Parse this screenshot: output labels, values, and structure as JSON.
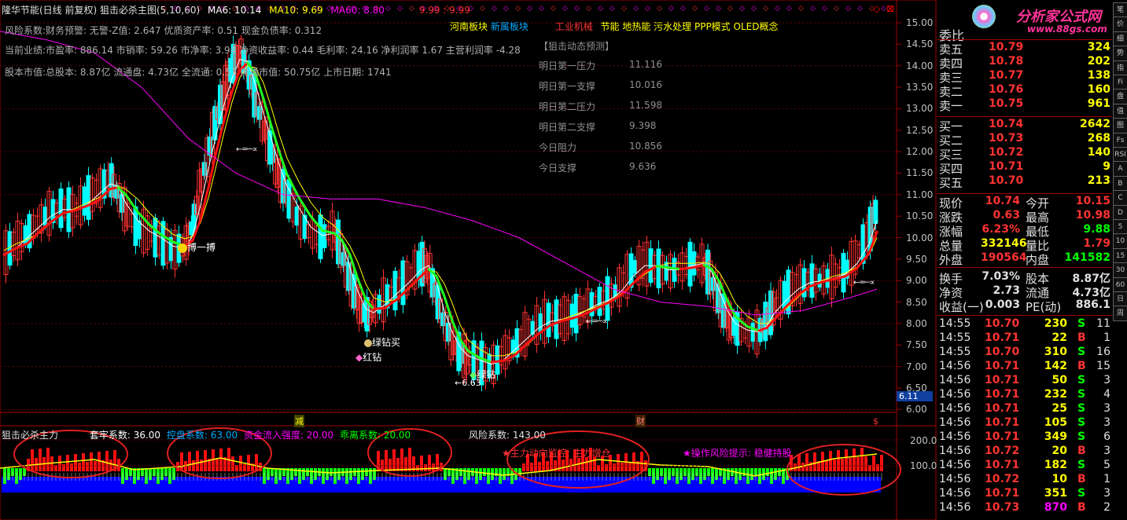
{
  "header": {
    "title": "隆华节能(日线 前复权) 狙击必杀主图(5,10,60)",
    "ma6": "MA6: 10.14",
    "ma10": "MA10: 9.69",
    "ma60": "MA60: 8.80",
    "extra": "9.99 : 9.99"
  },
  "info_lines": {
    "line1": "风险系数:财务预警: 无警-Z值: 2.647 优质资产率: 0.51 现金负债率: 0.312",
    "line2": "当前业绩:市盈率: 886.14 市销率: 59.26 市净率: 3.94 净资收益率: 0.44 毛利率: 24.16 净利润率 1.67 主营利润率 -4.28",
    "line3": "股本市值:总股本: 8.87亿 流通盘: 4.73亿 全流通: 0.53 流通市值: 50.75亿 上市日期: 1741"
  },
  "sectors": {
    "s1": "河南板块",
    "s2": "新属板块",
    "s3": "工业机械",
    "s4": "节能 地热能 污水处理 PPP模式 OLED概念"
  },
  "prediction": {
    "title": "【狙击动态预测】",
    "rows": [
      {
        "label": "明日第一压力",
        "value": "11.116"
      },
      {
        "label": "明日第一支撑",
        "value": "10.016"
      },
      {
        "label": "明日第二压力",
        "value": "11.598"
      },
      {
        "label": "明日第二支撑",
        "value": "9.398"
      },
      {
        "label": "今日阻力",
        "value": "10.856"
      },
      {
        "label": "今日支撑",
        "value": "9.636"
      }
    ]
  },
  "annotations": {
    "bo": "博一搏",
    "buy": "绿钻买",
    "red": "红钻",
    "low": "←6.63",
    "green": "绿钻",
    "jian": "减",
    "cai": "财",
    "dollar": "$",
    "price_tag": "6.11"
  },
  "price_axis": [
    "15.00",
    "14.50",
    "14.00",
    "13.50",
    "13.00",
    "12.50",
    "12.00",
    "11.50",
    "11.00",
    "10.50",
    "10.00",
    "9.50",
    "9.00",
    "8.50",
    "8.00",
    "7.50",
    "7.00",
    "6.50",
    "6.00"
  ],
  "sub_header": {
    "name": "狙击必杀主力",
    "l1": "套牢系数: 36.00",
    "l2": "控盘系数: 63.00",
    "l3": "资金流入强度: 20.00",
    "l4": "乖离系数: 20.00",
    "l5": "风险系数: 143.00"
  },
  "sub_axis": [
    "200.0",
    "100.0"
  ],
  "sub_notes": {
    "n1": "★主力动向监控: 主力增仓",
    "n2": "★操作风险提示: 稳健持股"
  },
  "logo": {
    "name": "分析家公式网",
    "url": "www.88gs.com"
  },
  "order_book": {
    "webi": "委比",
    "sells": [
      {
        "label": "卖五",
        "price": "10.79",
        "vol": "324"
      },
      {
        "label": "卖四",
        "price": "10.78",
        "vol": "202"
      },
      {
        "label": "卖三",
        "price": "10.77",
        "vol": "138"
      },
      {
        "label": "卖二",
        "price": "10.76",
        "vol": "160"
      },
      {
        "label": "卖一",
        "price": "10.75",
        "vol": "961"
      }
    ],
    "buys": [
      {
        "label": "买一",
        "price": "10.74",
        "vol": "2642"
      },
      {
        "label": "买二",
        "price": "10.73",
        "vol": "268"
      },
      {
        "label": "买三",
        "price": "10.72",
        "vol": "140"
      },
      {
        "label": "买四",
        "price": "10.71",
        "vol": "9"
      },
      {
        "label": "买五",
        "price": "10.70",
        "vol": "213"
      }
    ]
  },
  "quote": [
    {
      "l1": "现价",
      "v1": "10.74",
      "l2": "今开",
      "v2": "10.15"
    },
    {
      "l1": "涨跌",
      "v1": "0.63",
      "l2": "最高",
      "v2": "10.98"
    },
    {
      "l1": "涨幅",
      "v1": "6.23%",
      "l2": "最低",
      "v2": "9.88"
    },
    {
      "l1": "总量",
      "v1": "332146",
      "l2": "量比",
      "v2": "1.79"
    },
    {
      "l1": "外盘",
      "v1": "190564",
      "l2": "内盘",
      "v2": "141582"
    }
  ],
  "finance": [
    {
      "l1": "换手",
      "v1": "7.03%",
      "l2": "股本",
      "v2": "8.87亿"
    },
    {
      "l1": "净资",
      "v1": "2.73",
      "l2": "流通",
      "v2": "4.73亿"
    },
    {
      "l1": "收益(一)",
      "v1": "0.003",
      "l2": "PE(动)",
      "v2": "886.1"
    }
  ],
  "ticks": [
    {
      "t": "14:55",
      "p": "10.70",
      "v": "230",
      "d": "S",
      "n": "11"
    },
    {
      "t": "14:55",
      "p": "10.71",
      "v": "22",
      "d": "B",
      "n": "1"
    },
    {
      "t": "14:55",
      "p": "10.70",
      "v": "310",
      "d": "S",
      "n": "16"
    },
    {
      "t": "14:56",
      "p": "10.71",
      "v": "142",
      "d": "B",
      "n": "15"
    },
    {
      "t": "14:56",
      "p": "10.71",
      "v": "50",
      "d": "S",
      "n": "3"
    },
    {
      "t": "14:56",
      "p": "10.71",
      "v": "232",
      "d": "S",
      "n": "4"
    },
    {
      "t": "14:56",
      "p": "10.71",
      "v": "25",
      "d": "S",
      "n": "3"
    },
    {
      "t": "14:56",
      "p": "10.71",
      "v": "105",
      "d": "S",
      "n": "3"
    },
    {
      "t": "14:56",
      "p": "10.71",
      "v": "349",
      "d": "S",
      "n": "6"
    },
    {
      "t": "14:56",
      "p": "10.72",
      "v": "20",
      "d": "B",
      "n": "3"
    },
    {
      "t": "14:56",
      "p": "10.71",
      "v": "182",
      "d": "S",
      "n": "5"
    },
    {
      "t": "14:56",
      "p": "10.72",
      "v": "10",
      "d": "B",
      "n": "1"
    },
    {
      "t": "14:56",
      "p": "10.71",
      "v": "351",
      "d": "S",
      "n": "3"
    },
    {
      "t": "14:56",
      "p": "10.73",
      "v": "870",
      "d": "B",
      "n": "2"
    }
  ],
  "side_buttons": [
    "笔",
    "价",
    "细",
    "势",
    "指",
    "Fi",
    "盘",
    "值",
    "图",
    "Fs",
    "RSI",
    "A",
    "B",
    "C",
    "D",
    "5",
    "10",
    "15",
    "30",
    "60",
    "日",
    "周"
  ],
  "colors": {
    "up": "#ff3232",
    "down": "#00ffff",
    "ma5": "#ffffff",
    "ma10": "#ffff00",
    "ma60": "#ff00ff",
    "label": "#c0c0c0",
    "green": "#00ff00",
    "gridline": "#a00000"
  }
}
